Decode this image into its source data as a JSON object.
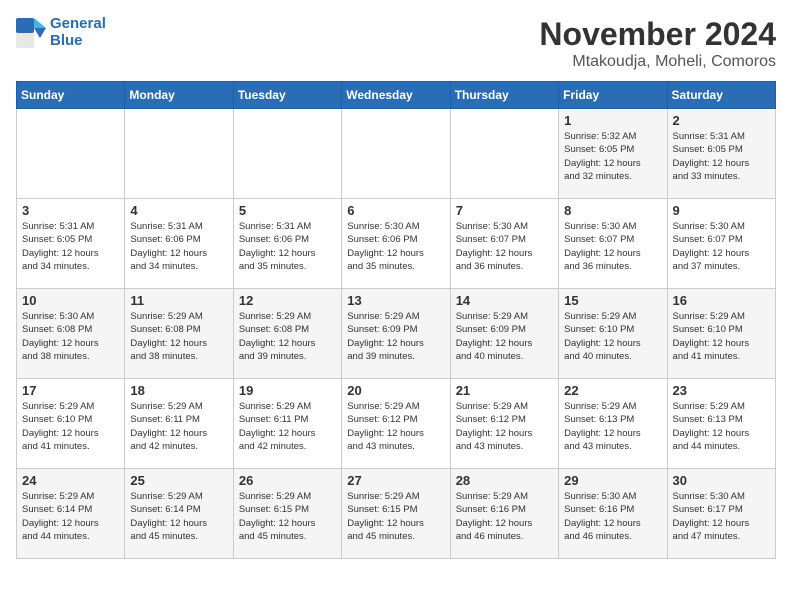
{
  "logo": {
    "line1": "General",
    "line2": "Blue"
  },
  "title": "November 2024",
  "subtitle": "Mtakoudja, Moheli, Comoros",
  "days_of_week": [
    "Sunday",
    "Monday",
    "Tuesday",
    "Wednesday",
    "Thursday",
    "Friday",
    "Saturday"
  ],
  "weeks": [
    [
      {
        "day": "",
        "info": ""
      },
      {
        "day": "",
        "info": ""
      },
      {
        "day": "",
        "info": ""
      },
      {
        "day": "",
        "info": ""
      },
      {
        "day": "",
        "info": ""
      },
      {
        "day": "1",
        "info": "Sunrise: 5:32 AM\nSunset: 6:05 PM\nDaylight: 12 hours\nand 32 minutes."
      },
      {
        "day": "2",
        "info": "Sunrise: 5:31 AM\nSunset: 6:05 PM\nDaylight: 12 hours\nand 33 minutes."
      }
    ],
    [
      {
        "day": "3",
        "info": "Sunrise: 5:31 AM\nSunset: 6:05 PM\nDaylight: 12 hours\nand 34 minutes."
      },
      {
        "day": "4",
        "info": "Sunrise: 5:31 AM\nSunset: 6:06 PM\nDaylight: 12 hours\nand 34 minutes."
      },
      {
        "day": "5",
        "info": "Sunrise: 5:31 AM\nSunset: 6:06 PM\nDaylight: 12 hours\nand 35 minutes."
      },
      {
        "day": "6",
        "info": "Sunrise: 5:30 AM\nSunset: 6:06 PM\nDaylight: 12 hours\nand 35 minutes."
      },
      {
        "day": "7",
        "info": "Sunrise: 5:30 AM\nSunset: 6:07 PM\nDaylight: 12 hours\nand 36 minutes."
      },
      {
        "day": "8",
        "info": "Sunrise: 5:30 AM\nSunset: 6:07 PM\nDaylight: 12 hours\nand 36 minutes."
      },
      {
        "day": "9",
        "info": "Sunrise: 5:30 AM\nSunset: 6:07 PM\nDaylight: 12 hours\nand 37 minutes."
      }
    ],
    [
      {
        "day": "10",
        "info": "Sunrise: 5:30 AM\nSunset: 6:08 PM\nDaylight: 12 hours\nand 38 minutes."
      },
      {
        "day": "11",
        "info": "Sunrise: 5:29 AM\nSunset: 6:08 PM\nDaylight: 12 hours\nand 38 minutes."
      },
      {
        "day": "12",
        "info": "Sunrise: 5:29 AM\nSunset: 6:08 PM\nDaylight: 12 hours\nand 39 minutes."
      },
      {
        "day": "13",
        "info": "Sunrise: 5:29 AM\nSunset: 6:09 PM\nDaylight: 12 hours\nand 39 minutes."
      },
      {
        "day": "14",
        "info": "Sunrise: 5:29 AM\nSunset: 6:09 PM\nDaylight: 12 hours\nand 40 minutes."
      },
      {
        "day": "15",
        "info": "Sunrise: 5:29 AM\nSunset: 6:10 PM\nDaylight: 12 hours\nand 40 minutes."
      },
      {
        "day": "16",
        "info": "Sunrise: 5:29 AM\nSunset: 6:10 PM\nDaylight: 12 hours\nand 41 minutes."
      }
    ],
    [
      {
        "day": "17",
        "info": "Sunrise: 5:29 AM\nSunset: 6:10 PM\nDaylight: 12 hours\nand 41 minutes."
      },
      {
        "day": "18",
        "info": "Sunrise: 5:29 AM\nSunset: 6:11 PM\nDaylight: 12 hours\nand 42 minutes."
      },
      {
        "day": "19",
        "info": "Sunrise: 5:29 AM\nSunset: 6:11 PM\nDaylight: 12 hours\nand 42 minutes."
      },
      {
        "day": "20",
        "info": "Sunrise: 5:29 AM\nSunset: 6:12 PM\nDaylight: 12 hours\nand 43 minutes."
      },
      {
        "day": "21",
        "info": "Sunrise: 5:29 AM\nSunset: 6:12 PM\nDaylight: 12 hours\nand 43 minutes."
      },
      {
        "day": "22",
        "info": "Sunrise: 5:29 AM\nSunset: 6:13 PM\nDaylight: 12 hours\nand 43 minutes."
      },
      {
        "day": "23",
        "info": "Sunrise: 5:29 AM\nSunset: 6:13 PM\nDaylight: 12 hours\nand 44 minutes."
      }
    ],
    [
      {
        "day": "24",
        "info": "Sunrise: 5:29 AM\nSunset: 6:14 PM\nDaylight: 12 hours\nand 44 minutes."
      },
      {
        "day": "25",
        "info": "Sunrise: 5:29 AM\nSunset: 6:14 PM\nDaylight: 12 hours\nand 45 minutes."
      },
      {
        "day": "26",
        "info": "Sunrise: 5:29 AM\nSunset: 6:15 PM\nDaylight: 12 hours\nand 45 minutes."
      },
      {
        "day": "27",
        "info": "Sunrise: 5:29 AM\nSunset: 6:15 PM\nDaylight: 12 hours\nand 45 minutes."
      },
      {
        "day": "28",
        "info": "Sunrise: 5:29 AM\nSunset: 6:16 PM\nDaylight: 12 hours\nand 46 minutes."
      },
      {
        "day": "29",
        "info": "Sunrise: 5:30 AM\nSunset: 6:16 PM\nDaylight: 12 hours\nand 46 minutes."
      },
      {
        "day": "30",
        "info": "Sunrise: 5:30 AM\nSunset: 6:17 PM\nDaylight: 12 hours\nand 47 minutes."
      }
    ]
  ]
}
